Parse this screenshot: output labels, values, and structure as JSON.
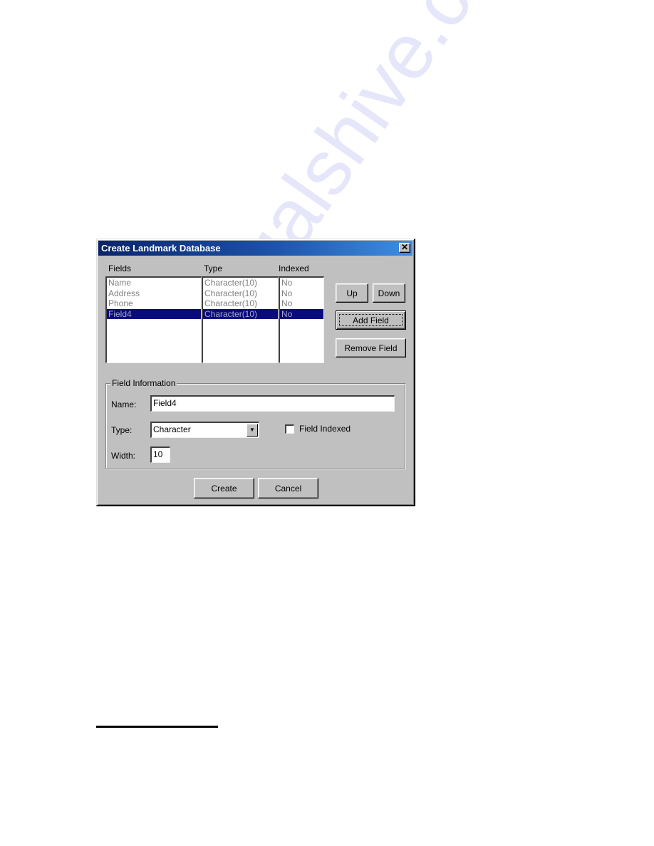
{
  "dialog": {
    "title": "Create Landmark Database",
    "close_icon": "close-icon"
  },
  "list": {
    "headers": {
      "fields": "Fields",
      "type": "Type",
      "indexed": "Indexed"
    },
    "rows": [
      {
        "field": "Name",
        "type": "Character(10)",
        "indexed": "No"
      },
      {
        "field": "Address",
        "type": "Character(10)",
        "indexed": "No"
      },
      {
        "field": "Phone",
        "type": "Character(10)",
        "indexed": "No"
      },
      {
        "field": "Field4",
        "type": "Character(10)",
        "indexed": "No"
      }
    ],
    "selected_index": 3
  },
  "buttons": {
    "up": "Up",
    "down": "Down",
    "add_field": "Add Field",
    "remove_field": "Remove Field",
    "create": "Create",
    "cancel": "Cancel"
  },
  "field_info": {
    "group_title": "Field Information",
    "name_label": "Name:",
    "name_value": "Field4",
    "type_label": "Type:",
    "type_value": "Character",
    "field_indexed_label": "Field Indexed",
    "field_indexed_checked": false,
    "width_label": "Width:",
    "width_value": "10"
  },
  "colors": {
    "selection": "#0a0a80",
    "title_bar_start": "#0a246a",
    "title_bar_end": "#3f8ee0",
    "dialog_face": "#c0c0c0"
  },
  "watermark": "manualshive.com"
}
